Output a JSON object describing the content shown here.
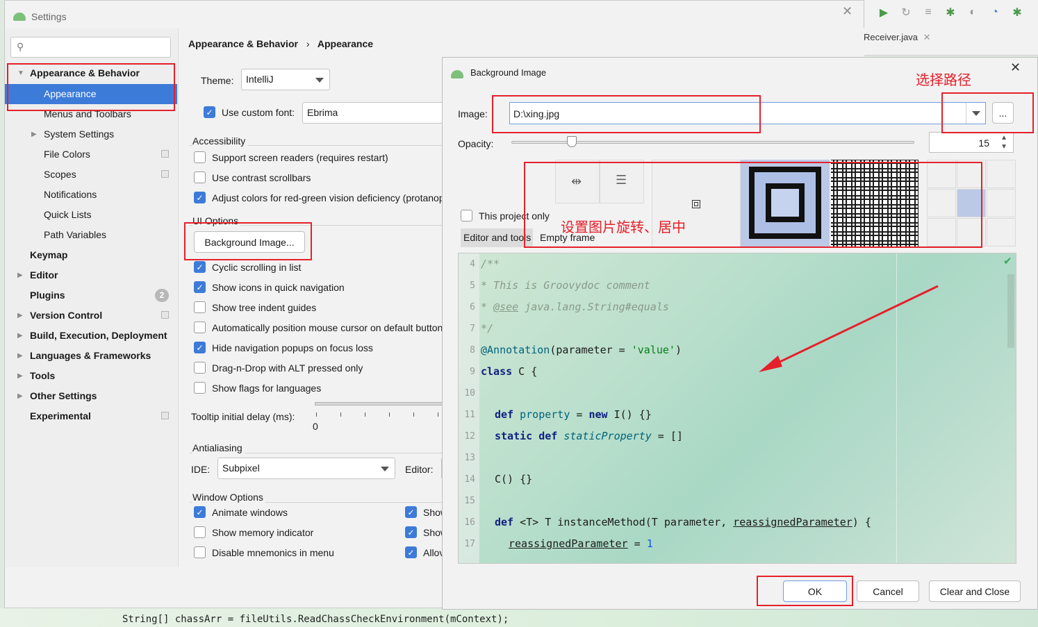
{
  "ide": {
    "tab_label": "Receiver.java",
    "code_line": "String[] chassArr = fileUtils.ReadChassCheckEnvironment(mContext);"
  },
  "settings": {
    "title": "Settings",
    "search_placeholder": "",
    "tree": [
      {
        "label": "Appearance & Behavior",
        "bold": true,
        "expanded": true
      },
      {
        "label": "Appearance",
        "selected": true
      },
      {
        "label": "Menus and Toolbars"
      },
      {
        "label": "System Settings"
      },
      {
        "label": "File Colors"
      },
      {
        "label": "Scopes"
      },
      {
        "label": "Notifications"
      },
      {
        "label": "Quick Lists"
      },
      {
        "label": "Path Variables"
      },
      {
        "label": "Keymap",
        "bold": true
      },
      {
        "label": "Editor",
        "bold": true
      },
      {
        "label": "Plugins",
        "bold": true,
        "badge": "2"
      },
      {
        "label": "Version Control",
        "bold": true
      },
      {
        "label": "Build, Execution, Deployment",
        "bold": true
      },
      {
        "label": "Languages & Frameworks",
        "bold": true
      },
      {
        "label": "Tools",
        "bold": true
      },
      {
        "label": "Other Settings",
        "bold": true
      },
      {
        "label": "Experimental",
        "bold": true
      }
    ],
    "breadcrumb": {
      "parent": "Appearance & Behavior",
      "sep": "›",
      "current": "Appearance"
    },
    "theme_label": "Theme:",
    "theme_value": "IntelliJ",
    "custom_font_label": "Use custom font:",
    "custom_font_value": "Ebrima",
    "accessibility_title": "Accessibility",
    "accessibility": [
      {
        "label": "Support screen readers (requires restart)",
        "checked": false
      },
      {
        "label": "Use contrast scrollbars",
        "checked": false
      },
      {
        "label": "Adjust colors for red-green vision deficiency (protanop",
        "checked": true
      }
    ],
    "ui_options_title": "UI Options",
    "background_image_button": "Background Image...",
    "ui_options": [
      {
        "label": "Cyclic scrolling in list",
        "checked": true
      },
      {
        "label": "Show icons in quick navigation",
        "checked": true
      },
      {
        "label": "Show tree indent guides",
        "checked": false
      },
      {
        "label": "Automatically position mouse cursor on default button",
        "checked": false
      },
      {
        "label": "Hide navigation popups on focus loss",
        "checked": true
      },
      {
        "label": "Drag-n-Drop with ALT pressed only",
        "checked": false
      },
      {
        "label": "Show flags for languages",
        "checked": false
      }
    ],
    "tooltip_label": "Tooltip initial delay (ms):",
    "tooltip_value": "0",
    "antialiasing_title": "Antialiasing",
    "ide_label": "IDE:",
    "ide_value": "Subpixel",
    "editor_label": "Editor:",
    "window_options_title": "Window Options",
    "window_options": [
      {
        "label": "Animate windows",
        "checked": true
      },
      {
        "label": "Show memory indicator",
        "checked": false
      },
      {
        "label": "Disable mnemonics in menu",
        "checked": false
      }
    ],
    "window_options_right": [
      {
        "label": "Show",
        "checked": true
      },
      {
        "label": "Show",
        "checked": true
      },
      {
        "label": "Allov",
        "checked": true
      }
    ]
  },
  "bg_dialog": {
    "title": "Background Image",
    "image_label": "Image:",
    "image_value": "D:\\xing.jpg",
    "browse_label": "...",
    "opacity_label": "Opacity:",
    "opacity_value": "15",
    "opacity_fraction": 0.15,
    "this_project_only": "This project only",
    "editor_and_tools": "Editor and tools",
    "empty_frame": "Empty frame",
    "ok_label": "OK",
    "cancel_label": "Cancel",
    "clear_close_label": "Clear and Close"
  },
  "annotations": {
    "choose_path": "选择路径",
    "rotate_center": "设置图片旋转、居中"
  },
  "code": [
    {
      "n": "4",
      "t": "/**"
    },
    {
      "n": "5",
      "t": "* This is Groovydoc comment"
    },
    {
      "n": "6",
      "t1": "* ",
      "t2": "@see",
      "t3": " java.lang.String#equals"
    },
    {
      "n": "7",
      "t": "*/"
    },
    {
      "n": "8",
      "a": "@Annotation",
      "b": "(parameter = ",
      "c": "'value'",
      "d": ")"
    },
    {
      "n": "9",
      "k": "class",
      "r": " C {"
    },
    {
      "n": "10"
    },
    {
      "n": "11",
      "k": "def",
      "f": "property",
      "r1": " = ",
      "k2": "new",
      "r2": " I() {}"
    },
    {
      "n": "12",
      "k": "static def",
      "f": "staticProperty",
      "r": " = []"
    },
    {
      "n": "13"
    },
    {
      "n": "14",
      "t": "C() {}"
    },
    {
      "n": "15"
    },
    {
      "n": "16",
      "k": "def",
      "r1": " <T> T instanceMethod(T parameter, ",
      "u": "reassignedParameter",
      "r2": ") {"
    },
    {
      "n": "17",
      "u": "reassignedParameter",
      "r": " = ",
      "num": "1"
    }
  ],
  "colors": {
    "accent": "#3d7bd9",
    "annotation_red": "#e5202a"
  }
}
